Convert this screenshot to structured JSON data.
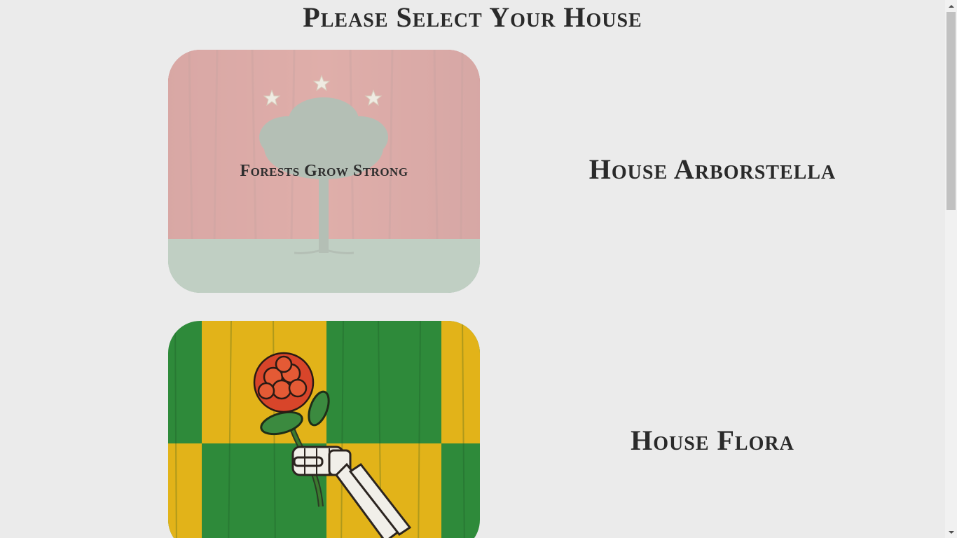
{
  "page": {
    "title": "Please Select Your House"
  },
  "houses": [
    {
      "name": "House Arborstella",
      "motto": "Forests Grow Strong",
      "sigil_icon": "tree-with-stars-icon",
      "colors": {
        "primary": "#c0352b",
        "secondary": "#5e8a6a"
      }
    },
    {
      "name": "House Flora",
      "motto": "",
      "sigil_icon": "skeleton-hand-rose-icon",
      "colors": {
        "primary": "#2e8a3a",
        "secondary": "#e2b319",
        "accent": "#d8452a"
      }
    }
  ]
}
